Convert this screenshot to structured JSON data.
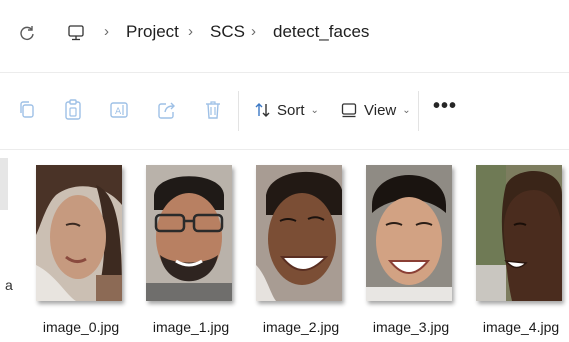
{
  "breadcrumb": {
    "computer_icon": "computer-icon",
    "items": [
      "Project",
      "SCS",
      "detect_faces"
    ]
  },
  "toolbar": {
    "sort_label": "Sort",
    "view_label": "View",
    "more_label": "•••",
    "icons": [
      "copy-icon",
      "paste-icon",
      "rename-icon",
      "share-icon",
      "delete-icon"
    ]
  },
  "nav": {
    "partial_label": "a"
  },
  "files": [
    {
      "name": "image_0.jpg"
    },
    {
      "name": "image_1.jpg"
    },
    {
      "name": "image_2.jpg"
    },
    {
      "name": "image_3.jpg"
    },
    {
      "name": "image_4.jpg"
    }
  ],
  "colors": {
    "accent": "#3b78c4",
    "disabled_icon": "#9ec0e6",
    "text": "#1b1b1b"
  }
}
